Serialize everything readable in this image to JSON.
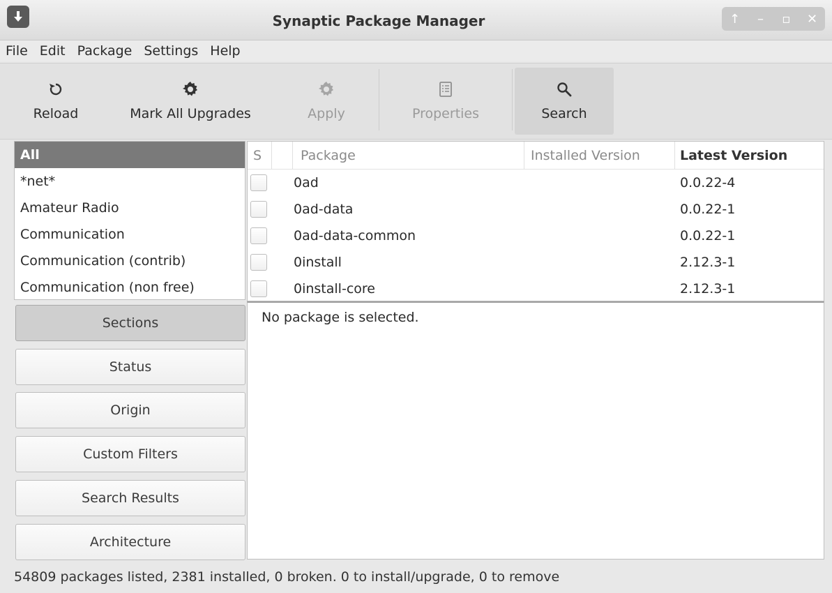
{
  "window": {
    "title": "Synaptic Package Manager"
  },
  "menu": [
    "File",
    "Edit",
    "Package",
    "Settings",
    "Help"
  ],
  "toolbar": {
    "reload": "Reload",
    "mark_all": "Mark All Upgrades",
    "apply": "Apply",
    "properties": "Properties",
    "search": "Search"
  },
  "sections": [
    "All",
    "*net*",
    "Amateur Radio",
    "Communication",
    "Communication (contrib)",
    "Communication (non free)"
  ],
  "filters": [
    "Sections",
    "Status",
    "Origin",
    "Custom Filters",
    "Search Results",
    "Architecture"
  ],
  "table": {
    "headers": {
      "s": "S",
      "package": "Package",
      "installed": "Installed Version",
      "latest": "Latest Version"
    },
    "rows": [
      {
        "name": "0ad",
        "installed": "",
        "latest": "0.0.22-4"
      },
      {
        "name": "0ad-data",
        "installed": "",
        "latest": "0.0.22-1"
      },
      {
        "name": "0ad-data-common",
        "installed": "",
        "latest": "0.0.22-1"
      },
      {
        "name": "0install",
        "installed": "",
        "latest": "2.12.3-1"
      },
      {
        "name": "0install-core",
        "installed": "",
        "latest": "2.12.3-1"
      }
    ]
  },
  "details": {
    "message": "No package is selected."
  },
  "status": "54809 packages listed, 2381 installed, 0 broken. 0 to install/upgrade, 0 to remove",
  "icons": {
    "app": "download-arrow-icon",
    "reload": "reload-icon",
    "mark_all": "gear-icon",
    "apply": "gear-icon",
    "properties": "properties-list-icon",
    "search": "magnifier-icon"
  }
}
